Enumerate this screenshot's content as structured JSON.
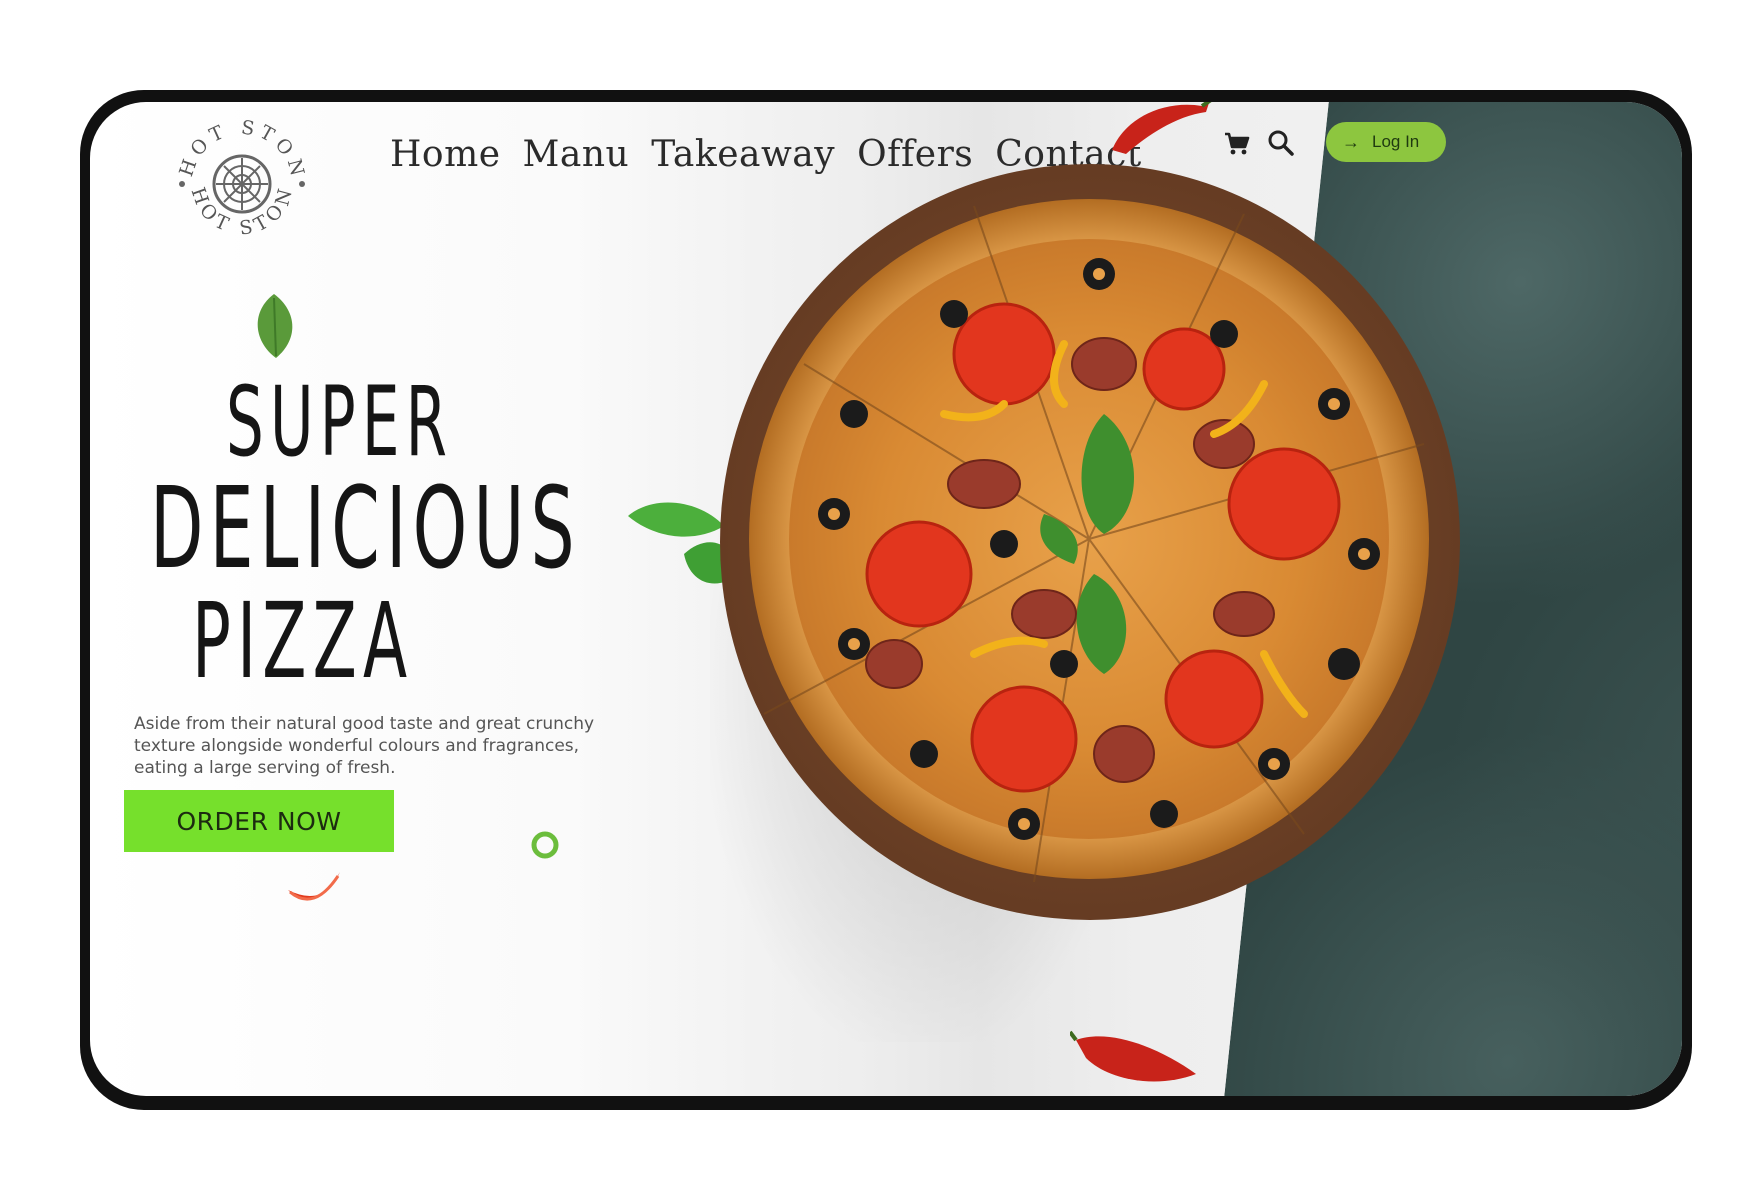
{
  "brand": {
    "logo_text": "HOT STONE"
  },
  "nav": {
    "items": [
      {
        "label": "Home"
      },
      {
        "label": "Manu"
      },
      {
        "label": "Takeaway"
      },
      {
        "label": "Offers"
      },
      {
        "label": "Contact"
      }
    ]
  },
  "header_icons": [
    "cart-icon",
    "search-icon"
  ],
  "login": {
    "label": "Log In",
    "icon": "arrow-right-icon"
  },
  "hero": {
    "line1": "SUPER",
    "line2": "DELICIOUS",
    "line3": "PIZZA",
    "description": "Aside from their natural good taste and great crunchy texture alongside wonderful colours and fragrances, eating a large serving of fresh.",
    "cta": "ORDER NOW"
  },
  "colors": {
    "accent": "#76e02c",
    "login_bg": "#8dc63f",
    "stone": "#2f4543",
    "frame": "#111111"
  }
}
